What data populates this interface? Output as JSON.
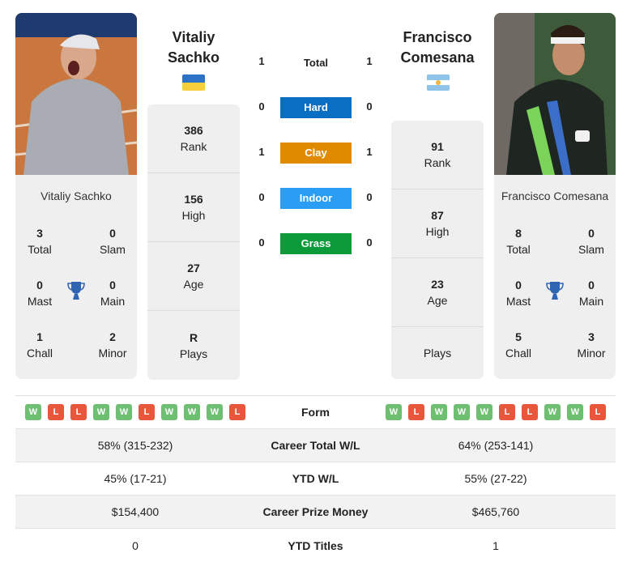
{
  "player1": {
    "name_line1": "Vitaliy",
    "name_line2": "Sachko",
    "full_name": "Vitaliy Sachko",
    "flag": "ukraine-flag",
    "titles": {
      "total": {
        "value": "3",
        "label": "Total"
      },
      "slam": {
        "value": "0",
        "label": "Slam"
      },
      "mast": {
        "value": "0",
        "label": "Mast"
      },
      "main": {
        "value": "0",
        "label": "Main"
      },
      "chall": {
        "value": "1",
        "label": "Chall"
      },
      "minor": {
        "value": "2",
        "label": "Minor"
      }
    },
    "info": [
      {
        "value": "386",
        "label": "Rank"
      },
      {
        "value": "156",
        "label": "High"
      },
      {
        "value": "27",
        "label": "Age"
      },
      {
        "value": "R",
        "label": "Plays"
      }
    ],
    "form": [
      "W",
      "L",
      "L",
      "W",
      "W",
      "L",
      "W",
      "W",
      "W",
      "L"
    ],
    "career_wl": "58% (315-232)",
    "ytd_wl": "45% (17-21)",
    "prize_money": "$154,400",
    "ytd_titles": "0"
  },
  "player2": {
    "name_line1": "Francisco",
    "name_line2": "Comesana",
    "full_name": "Francisco Comesana",
    "flag": "argentina-flag",
    "titles": {
      "total": {
        "value": "8",
        "label": "Total"
      },
      "slam": {
        "value": "0",
        "label": "Slam"
      },
      "mast": {
        "value": "0",
        "label": "Mast"
      },
      "main": {
        "value": "0",
        "label": "Main"
      },
      "chall": {
        "value": "5",
        "label": "Chall"
      },
      "minor": {
        "value": "3",
        "label": "Minor"
      }
    },
    "info": [
      {
        "value": "91",
        "label": "Rank"
      },
      {
        "value": "87",
        "label": "High"
      },
      {
        "value": "23",
        "label": "Age"
      },
      {
        "value": "",
        "label": "Plays"
      }
    ],
    "form": [
      "W",
      "L",
      "W",
      "W",
      "W",
      "L",
      "L",
      "W",
      "W",
      "L"
    ],
    "career_wl": "64% (253-141)",
    "ytd_wl": "55% (27-22)",
    "prize_money": "$465,760",
    "ytd_titles": "1"
  },
  "h2h": {
    "total": {
      "label": "Total",
      "p1": "1",
      "p2": "1"
    },
    "surfaces": [
      {
        "label": "Hard",
        "p1": "0",
        "p2": "0",
        "color": "#0a6fc2"
      },
      {
        "label": "Clay",
        "p1": "1",
        "p2": "1",
        "color": "#e08a00"
      },
      {
        "label": "Indoor",
        "p1": "0",
        "p2": "0",
        "color": "#2a9df4"
      },
      {
        "label": "Grass",
        "p1": "0",
        "p2": "0",
        "color": "#0c9a3a"
      }
    ]
  },
  "table_labels": {
    "form": "Form",
    "career_wl": "Career Total W/L",
    "ytd_wl": "YTD W/L",
    "prize_money": "Career Prize Money",
    "ytd_titles": "YTD Titles"
  }
}
